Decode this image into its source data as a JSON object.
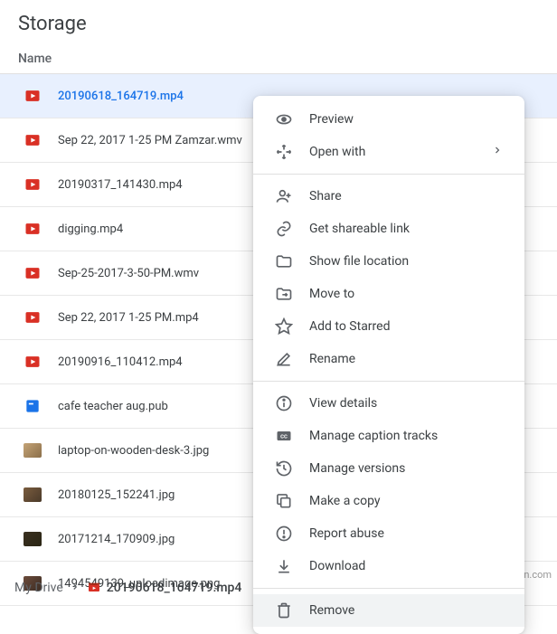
{
  "header": {
    "title": "Storage"
  },
  "columns": {
    "name_header": "Name"
  },
  "files": [
    {
      "name": "20190618_164719.mp4",
      "icon": "video-icon",
      "selected": true
    },
    {
      "name": "Sep 22, 2017 1-25 PM Zamzar.wmv",
      "icon": "video-icon"
    },
    {
      "name": "20190317_141430.mp4",
      "icon": "video-icon"
    },
    {
      "name": "digging.mp4",
      "icon": "video-icon"
    },
    {
      "name": "Sep-25-2017-3-50-PM.wmv",
      "icon": "video-icon"
    },
    {
      "name": "Sep 22, 2017 1-25 PM.mp4",
      "icon": "video-icon"
    },
    {
      "name": "20190916_110412.mp4",
      "icon": "video-icon"
    },
    {
      "name": "cafe teacher aug.pub",
      "icon": "pub-icon"
    },
    {
      "name": "laptop-on-wooden-desk-3.jpg",
      "icon": "image-thumb-a"
    },
    {
      "name": "20180125_152241.jpg",
      "icon": "image-thumb-b"
    },
    {
      "name": "20171214_170909.jpg",
      "icon": "image-thumb-c"
    },
    {
      "name": "1494549139_uploadimage.png",
      "icon": "image-thumb-d"
    }
  ],
  "context_menu": {
    "preview": "Preview",
    "open_with": "Open with",
    "share": "Share",
    "get_link": "Get shareable link",
    "show_location": "Show file location",
    "move_to": "Move to",
    "add_starred": "Add to Starred",
    "rename": "Rename",
    "view_details": "View details",
    "manage_captions": "Manage caption tracks",
    "manage_versions": "Manage versions",
    "make_copy": "Make a copy",
    "report_abuse": "Report abuse",
    "download": "Download",
    "remove": "Remove"
  },
  "breadcrumb": {
    "root": "My Drive",
    "current": "20190618_164719.mp4"
  },
  "watermark": "wsxdn.com",
  "colors": {
    "selected_bg": "#e8f0fe",
    "selected_text": "#1a73e8",
    "icon": "#5f6368"
  }
}
